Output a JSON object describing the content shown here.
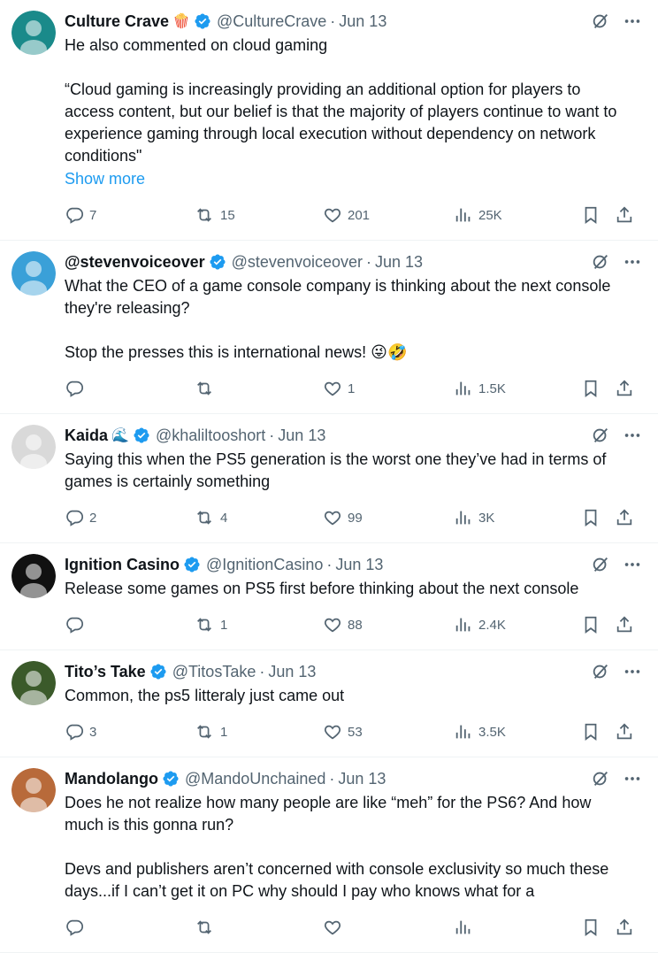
{
  "tweets": [
    {
      "name": "Culture Crave",
      "emoji": "🍿",
      "handle": "@CultureCrave",
      "date": "Jun 13",
      "text": "He also commented on cloud gaming\n\n“Cloud gaming is increasingly providing an additional option for players to access content, but our belief is that the majority of players continue to want to experience gaming through local execution without dependency on network conditions\"",
      "show_more": "Show more",
      "replies": "7",
      "reposts": "15",
      "likes": "201",
      "views": "25K",
      "avatar_color": "#1a8a8a"
    },
    {
      "name": "@stevenvoiceover",
      "emoji": "",
      "handle": "@stevenvoiceover",
      "date": "Jun 13",
      "text": "What the CEO of a game console company is thinking about the next console they're releasing?\n\nStop the presses this is international news! 😜🤣",
      "replies": "",
      "reposts": "",
      "likes": "1",
      "views": "1.5K",
      "avatar_color": "#3aa0d8"
    },
    {
      "name": "Kaida",
      "emoji": "🌊",
      "handle": "@khaliltooshort",
      "date": "Jun 13",
      "text": "Saying this when the PS5 generation is the worst one they’ve had in terms of games is certainly something",
      "replies": "2",
      "reposts": "4",
      "likes": "99",
      "views": "3K",
      "avatar_color": "#d9d9d9"
    },
    {
      "name": "Ignition Casino",
      "emoji": "",
      "handle": "@IgnitionCasino",
      "date": "Jun 13",
      "text": "Release some games on PS5 first before thinking about the next console",
      "replies": "",
      "reposts": "1",
      "likes": "88",
      "views": "2.4K",
      "avatar_color": "#111111"
    },
    {
      "name": "Tito’s Take",
      "emoji": "",
      "handle": "@TitosTake",
      "date": "Jun 13",
      "text": "Common, the ps5 litteraly just came out",
      "replies": "3",
      "reposts": "1",
      "likes": "53",
      "views": "3.5K",
      "avatar_color": "#3b5a2a"
    },
    {
      "name": "Mandolango",
      "emoji": "",
      "handle": "@MandoUnchained",
      "date": "Jun 13",
      "text": "Does he not realize how many people are like “meh” for the PS6? And how much is this gonna run?\n\nDevs and publishers aren’t concerned with console exclusivity so much these days...if I can’t get it on PC why should I pay who knows what for a",
      "replies": "",
      "reposts": "",
      "likes": "",
      "views": "",
      "avatar_color": "#b86a3a"
    }
  ],
  "icons": {
    "verified": "verified-badge-icon",
    "grok": "grok-icon",
    "more": "more-icon",
    "reply": "reply-icon",
    "repost": "repost-icon",
    "like": "like-icon",
    "views": "views-icon",
    "bookmark": "bookmark-icon",
    "share": "share-icon"
  },
  "colors": {
    "accent": "#1d9bf0",
    "secondary_text": "#536471",
    "divider": "#eff3f4"
  }
}
